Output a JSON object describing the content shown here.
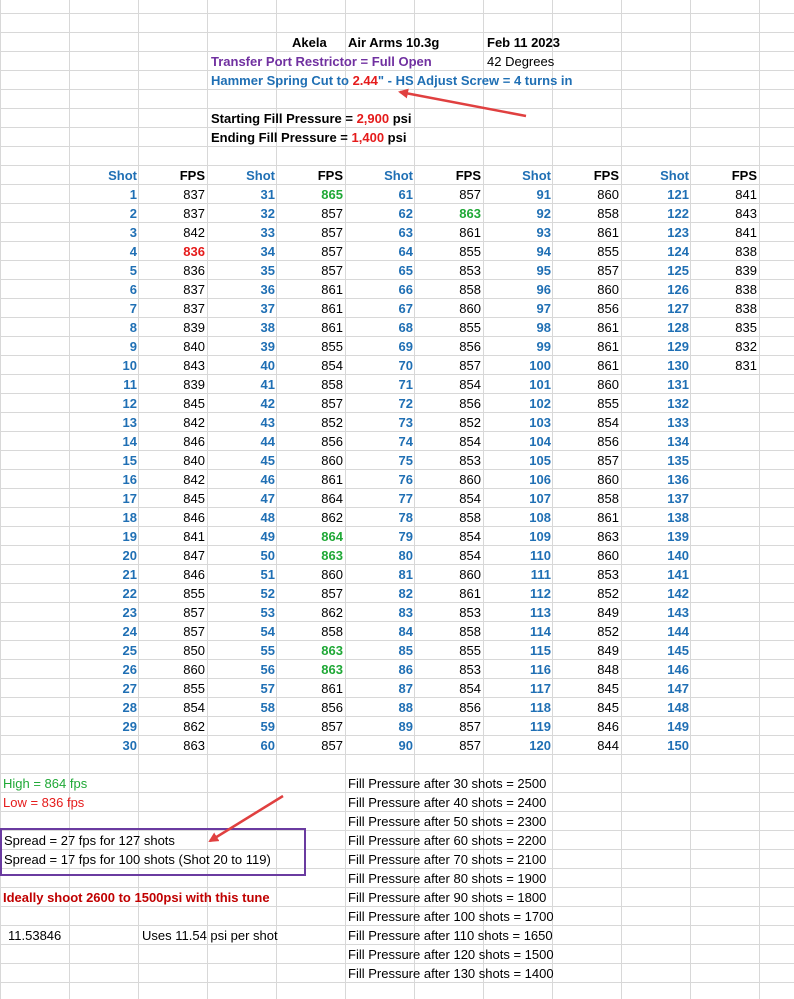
{
  "header": {
    "name": "Akela",
    "pellet": "Air Arms 10.3g",
    "date": "Feb 11 2023",
    "temperature": "42 Degrees",
    "transfer_port": "Transfer Port Restrictor = Full Open",
    "hammer_a": "Hammer Spring Cut to ",
    "hammer_value": "2.44",
    "hammer_b": "\" - HS Adjust Screw = 4 turns in",
    "start_label": "Starting Fill Pressure = ",
    "start_value": "2,900",
    "start_unit": " psi",
    "end_label": "Ending  Fill Pressure = ",
    "end_value": "1,400",
    "end_unit": " psi"
  },
  "columns": {
    "shot": "Shot",
    "fps": "FPS"
  },
  "fps_values": [
    837,
    837,
    842,
    836,
    836,
    837,
    837,
    839,
    840,
    843,
    839,
    845,
    842,
    846,
    840,
    842,
    845,
    846,
    841,
    847,
    846,
    855,
    857,
    857,
    850,
    860,
    855,
    854,
    862,
    863,
    865,
    857,
    857,
    857,
    857,
    861,
    861,
    861,
    855,
    854,
    858,
    857,
    852,
    856,
    860,
    861,
    864,
    862,
    864,
    863,
    860,
    857,
    862,
    858,
    863,
    863,
    861,
    856,
    857,
    857,
    857,
    863,
    861,
    855,
    853,
    858,
    860,
    855,
    856,
    857,
    854,
    856,
    852,
    854,
    853,
    860,
    854,
    858,
    854,
    854,
    860,
    861,
    853,
    858,
    855,
    853,
    854,
    856,
    857,
    857,
    860,
    858,
    861,
    855,
    857,
    860,
    856,
    861,
    861,
    861,
    860,
    855,
    854,
    856,
    857,
    860,
    858,
    861,
    863,
    860,
    853,
    852,
    849,
    852,
    849,
    848,
    845,
    845,
    846,
    844,
    841,
    843,
    841,
    838,
    839,
    838,
    838,
    835,
    832,
    831
  ],
  "highlight_red_shots": [
    4
  ],
  "highlight_green_shots": [
    31,
    49,
    50,
    55,
    56,
    62
  ],
  "total_shot_numbers": 150,
  "stats": {
    "high": "High = 864 fps",
    "low": "Low = 836 fps",
    "spread1": "Spread = 27 fps for 127 shots",
    "spread2": "Spread = 17 fps for 100 shots (Shot 20 to 119)",
    "ideal": "Ideally shoot 2600 to 1500psi with this tune",
    "psi_per_shot_value": "11.53846",
    "psi_per_shot_label": "Uses 11.54 psi per shot"
  },
  "fill_pressures": [
    "Fill Pressure after 30 shots = 2500",
    "Fill Pressure after 40 shots = 2400",
    "Fill Pressure after 50 shots = 2300",
    "Fill Pressure after 60 shots = 2200",
    "Fill Pressure after 70 shots = 2100",
    "Fill Pressure after 80 shots = 1900",
    "Fill Pressure after 90 shots = 1800",
    "Fill Pressure after 100 shots = 1700",
    "Fill Pressure after 110 shots = 1650",
    "Fill Pressure after 120 shots = 1500",
    "Fill Pressure after 130 shots = 1400"
  ],
  "colors": {
    "shot_blue": "#1f6fb4",
    "red": "#e51b1b",
    "green": "#1fa836",
    "purple": "#7030a0",
    "darkred": "#c00000",
    "arrow": "#e04040"
  }
}
